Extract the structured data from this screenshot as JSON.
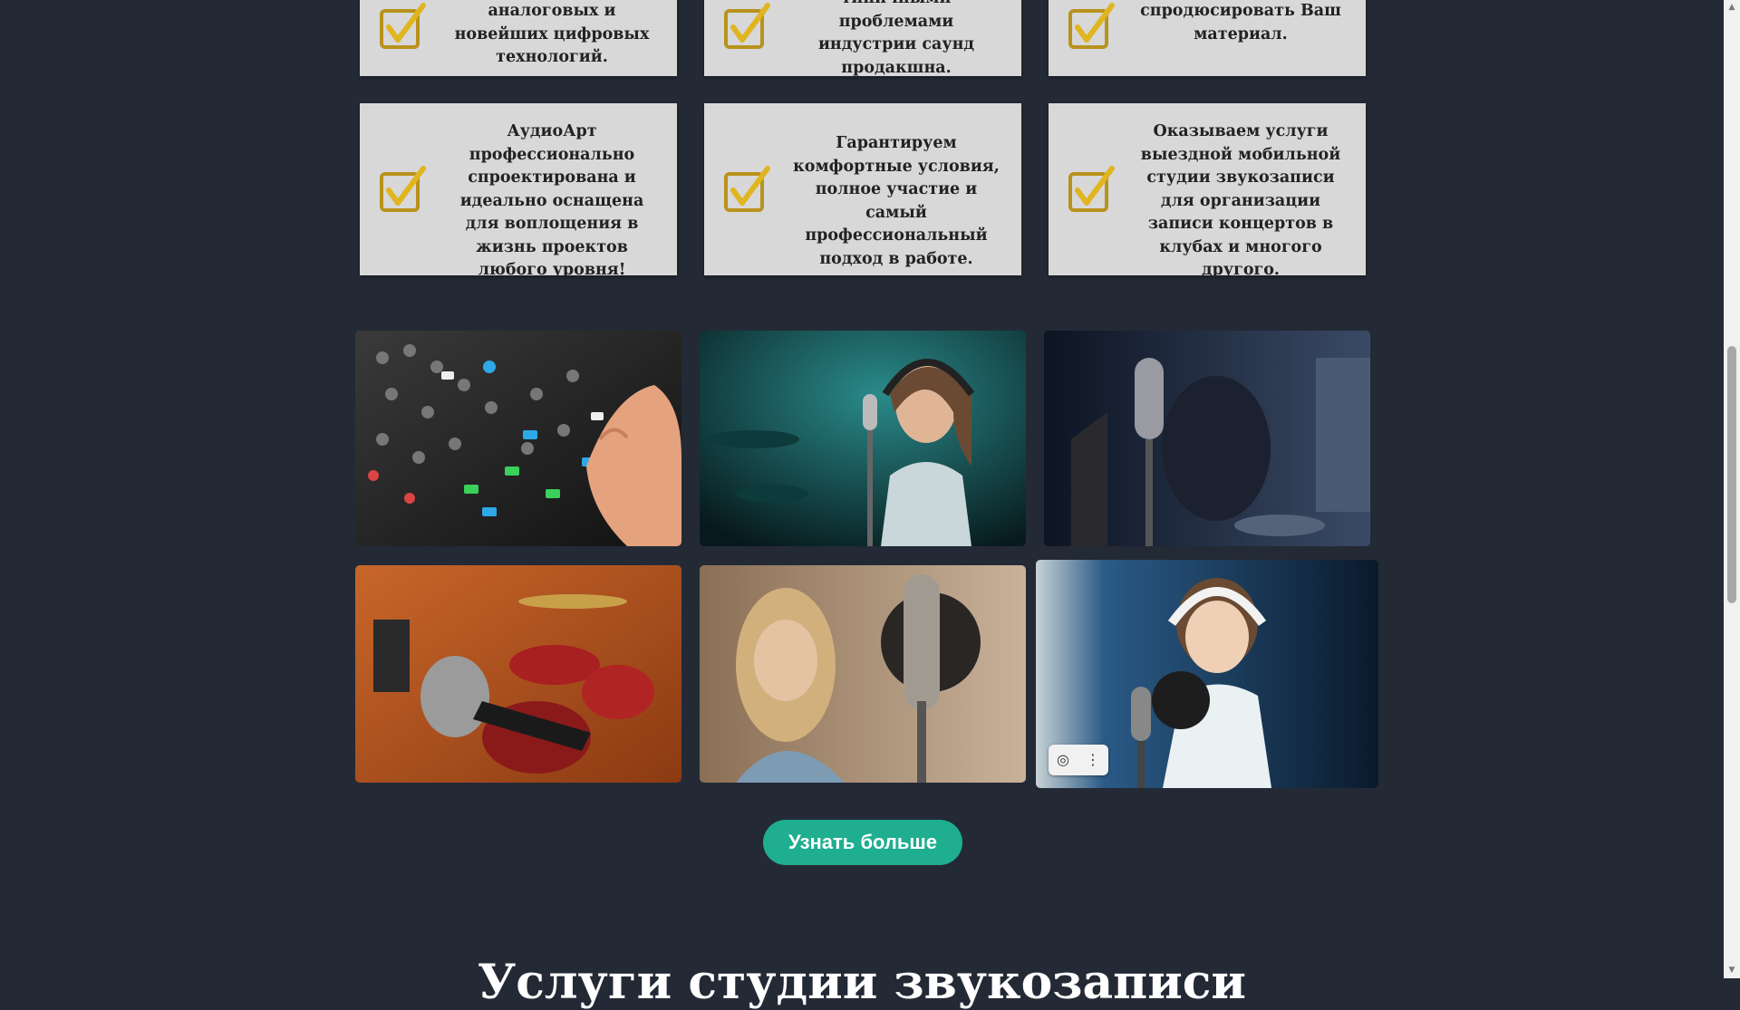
{
  "features_top": [
    {
      "text": "аналоговых и новейших цифровых технологий."
    },
    {
      "text": "типичными проблемами индустрии саунд продакшна."
    },
    {
      "text": "спродюсировать Ваш материал."
    }
  ],
  "features": [
    {
      "text": "АудиоАрт профессионально спроектирована и идеально оснащена для воплощения в жизнь проектов любого уровня!"
    },
    {
      "text": "Гарантируем комфортные условия, полное участие и самый профессиональный подход в работе."
    },
    {
      "text": "Оказываем услуги выездной мобильной студии звукозаписи для организации записи концертов в клубах и многого другого."
    }
  ],
  "gallery": {
    "photos": [
      "mixing-console",
      "female-singer-microphone",
      "studio-condenser-microphone",
      "microphone-and-drums",
      "blonde-singer-microphone",
      "child-singer-headphones"
    ],
    "tools": {
      "lens_icon": "lens-icon",
      "more_icon": "more-options-icon"
    }
  },
  "cta": {
    "label": "Узнать больше"
  },
  "next_section": {
    "heading": "Услуги студии звукозаписи"
  },
  "colors": {
    "background": "#232a35",
    "card": "#d8d8d8",
    "accent": "#1fae8f"
  }
}
